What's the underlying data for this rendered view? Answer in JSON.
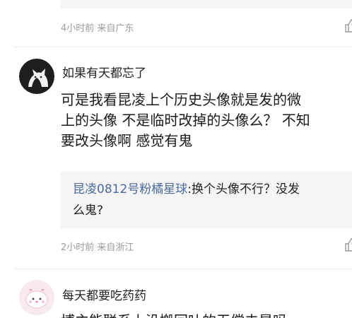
{
  "comments": [
    {
      "meta": "4小时前 来自广东"
    },
    {
      "username": "如果有天都忘了",
      "body_lines": [
        "可是我看昆凌上个历史头像就是发的微",
        "上的头像 不是临时改掉的头像么？ 不知",
        "要改头像啊 感觉有鬼"
      ],
      "reply": {
        "user": "昆凌0812号粉橘星球",
        "text_line1": ":换个头像不行？没发",
        "text_line2": "么鬼?"
      },
      "meta": "2小时前 来自浙江"
    },
    {
      "username": "每天都要吃药药",
      "body_partial": "博主能联系上没搬回吐的无偿去是吗"
    }
  ],
  "icons": {
    "edge_icon": "thumbs-up-icon",
    "avatar_1": "cat-silhouette-avatar",
    "avatar_2": "pink-cartoon-avatar"
  },
  "colors": {
    "reply_user": "#4c6a9f",
    "meta_text": "#9b9b9b",
    "quote_background": "#f5f5f5"
  }
}
